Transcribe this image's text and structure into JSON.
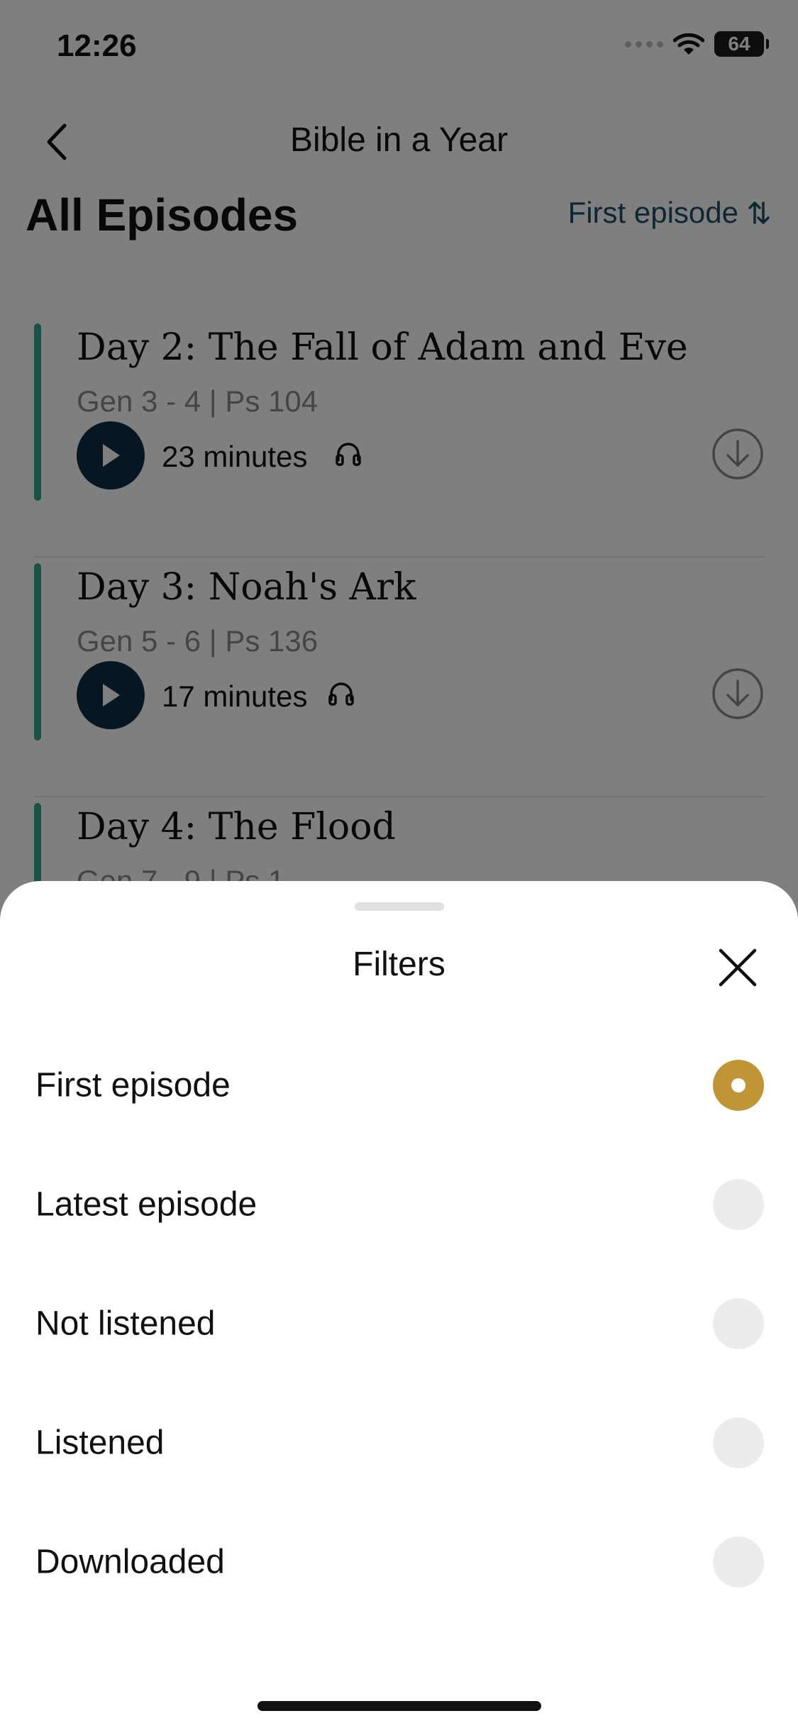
{
  "status_bar": {
    "time": "12:26",
    "battery": "64"
  },
  "nav": {
    "title": "Bible in a Year"
  },
  "header": {
    "title": "All Episodes",
    "sort_label": "First episode"
  },
  "episodes": [
    {
      "title": "Day 2: The Fall of Adam and Eve",
      "ref": "Gen 3 - 4 | Ps 104",
      "duration": "23 minutes"
    },
    {
      "title": "Day 3: Noah's Ark",
      "ref": "Gen 5 - 6 | Ps 136",
      "duration": "17 minutes"
    },
    {
      "title": "Day 4: The Flood",
      "ref": "Gen 7 - 9 | Ps 1",
      "duration": ""
    }
  ],
  "sheet": {
    "title": "Filters",
    "options": [
      {
        "label": "First episode",
        "selected": true
      },
      {
        "label": "Latest episode",
        "selected": false
      },
      {
        "label": "Not listened",
        "selected": false
      },
      {
        "label": "Listened",
        "selected": false
      },
      {
        "label": "Downloaded",
        "selected": false
      }
    ]
  },
  "colors": {
    "accent_gold": "#c09535",
    "play_navy": "#0d2f47",
    "progress_teal": "#3aa08f",
    "link_blue": "#1d4e66"
  },
  "icons": [
    "back-chevron-icon",
    "sort-arrows-icon",
    "play-icon",
    "headphones-icon",
    "download-icon",
    "close-icon",
    "wifi-icon",
    "battery-icon"
  ]
}
